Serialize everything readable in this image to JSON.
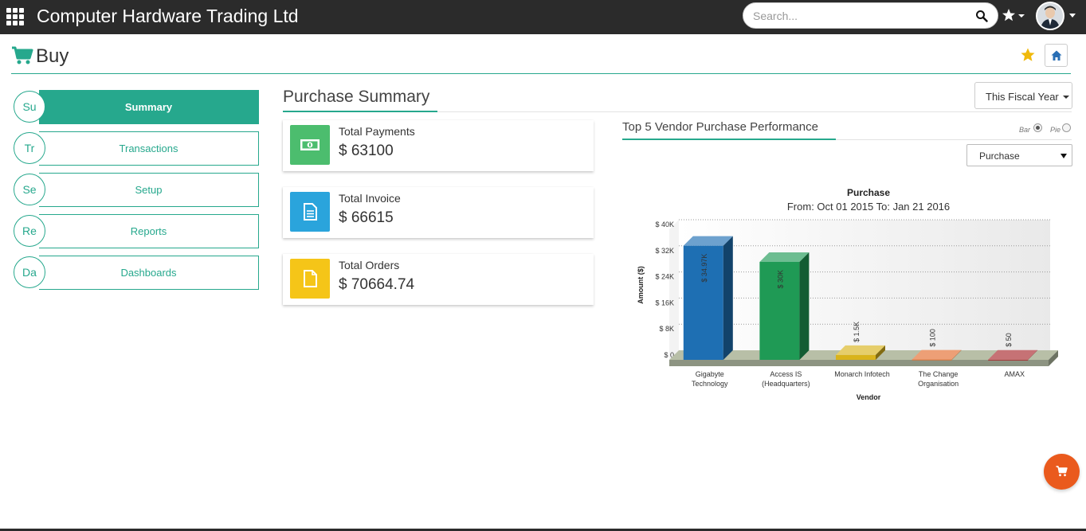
{
  "app": {
    "title": "Computer Hardware Trading Ltd",
    "search_placeholder": "Search..."
  },
  "page": {
    "title": "Buy"
  },
  "sidebar": {
    "items": [
      {
        "abbr": "Su",
        "label": "Summary",
        "active": true
      },
      {
        "abbr": "Tr",
        "label": "Transactions",
        "active": false
      },
      {
        "abbr": "Se",
        "label": "Setup",
        "active": false
      },
      {
        "abbr": "Re",
        "label": "Reports",
        "active": false
      },
      {
        "abbr": "Da",
        "label": "Dashboards",
        "active": false
      }
    ]
  },
  "summary": {
    "title": "Purchase Summary",
    "period_label": "This Fiscal Year",
    "cards": [
      {
        "label": "Total Payments",
        "value": "$ 63100",
        "color": "#4cbd6e",
        "icon": "money-icon"
      },
      {
        "label": "Total Invoice",
        "value": "$ 66615",
        "color": "#2aa4dc",
        "icon": "invoice-icon"
      },
      {
        "label": "Total Orders",
        "value": "$ 70664.74",
        "color": "#f5c518",
        "icon": "order-icon"
      }
    ]
  },
  "vendor_panel": {
    "title": "Top 5 Vendor Purchase Performance",
    "toggle_bar": "Bar",
    "toggle_pie": "Pie",
    "selected_toggle": "Bar",
    "metric_select": "Purchase"
  },
  "chart_data": {
    "type": "bar",
    "title": "Purchase",
    "subtitle": "From: Oct 01 2015 To: Jan 21 2016",
    "xlabel": "Vendor",
    "ylabel": "Amount ($)",
    "ylim": [
      0,
      40000
    ],
    "yticks": [
      0,
      8000,
      16000,
      24000,
      32000,
      40000
    ],
    "ytick_labels": [
      "$ 0",
      "$ 8K",
      "$ 16K",
      "$ 24K",
      "$ 32K",
      "$ 40K"
    ],
    "grid": true,
    "categories": [
      [
        "Gigabyte",
        "Technology"
      ],
      [
        "Access IS",
        "(Headquarters)"
      ],
      [
        "Monarch Infotech"
      ],
      [
        "The Change",
        "Organisation"
      ],
      [
        "AMAX"
      ]
    ],
    "values": [
      34970,
      30000,
      1500,
      100,
      50
    ],
    "data_labels": [
      "$ 34.97K",
      "$ 30K",
      "$ 1.5K",
      "$ 100",
      "$ 50"
    ],
    "colors": [
      "#1e6fb3",
      "#1f9a55",
      "#d9b31c",
      "#e36b2c",
      "#a8262a"
    ]
  },
  "colors": {
    "accent": "#26a88d",
    "topbar": "#2b2b2b",
    "fab": "#ea5a1d"
  }
}
